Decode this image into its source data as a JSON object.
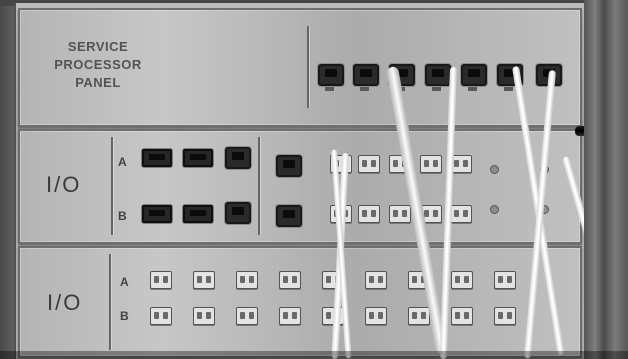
{
  "panels": {
    "service_processor": {
      "title_lines": [
        "SERVICE",
        "PROCESSOR",
        "PANEL"
      ]
    },
    "io_top": {
      "label": "I/O",
      "row_a": "A",
      "row_b": "B"
    },
    "io_bottom": {
      "label": "I/O",
      "row_a": "A",
      "row_b": "B"
    }
  },
  "colors": {
    "metal": "#b5b5b5",
    "dark_port": "#2f2f2f",
    "light_port": "#dedede",
    "cable_white": "#f5f5f5"
  }
}
